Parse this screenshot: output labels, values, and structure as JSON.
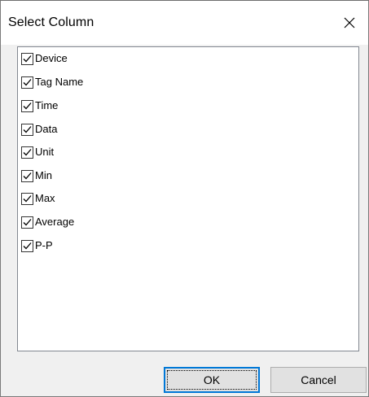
{
  "dialog": {
    "title": "Select Column"
  },
  "icons": {
    "close": "close-icon",
    "check": "checkmark-icon"
  },
  "columns": [
    {
      "label": "Device",
      "checked": true
    },
    {
      "label": "Tag Name",
      "checked": true
    },
    {
      "label": "Time",
      "checked": true
    },
    {
      "label": "Data",
      "checked": true
    },
    {
      "label": "Unit",
      "checked": true
    },
    {
      "label": "Min",
      "checked": true
    },
    {
      "label": "Max",
      "checked": true
    },
    {
      "label": "Average",
      "checked": true
    },
    {
      "label": "P-P",
      "checked": true
    }
  ],
  "buttons": {
    "ok_label": "OK",
    "cancel_label": "Cancel"
  },
  "colors": {
    "default_button_border": "#0078d7"
  }
}
